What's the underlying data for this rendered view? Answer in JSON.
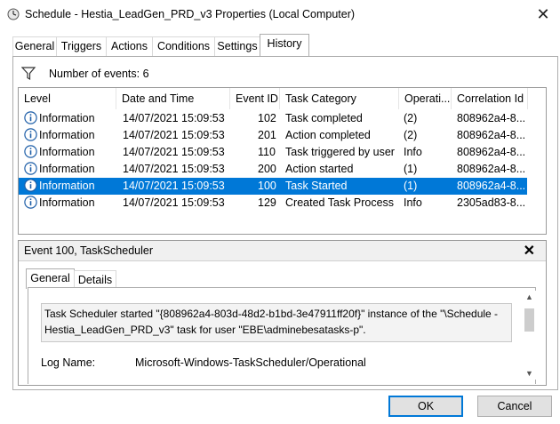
{
  "window": {
    "title": "Schedule - Hestia_LeadGen_PRD_v3 Properties (Local Computer)"
  },
  "tabs": [
    {
      "label": "General"
    },
    {
      "label": "Triggers"
    },
    {
      "label": "Actions"
    },
    {
      "label": "Conditions"
    },
    {
      "label": "Settings"
    },
    {
      "label": "History",
      "active": true
    }
  ],
  "history": {
    "filter_icon": "funnel-icon",
    "count_label": "Number of events: 6",
    "columns": [
      "Level",
      "Date and Time",
      "Event ID",
      "Task Category",
      "Operati...",
      "Correlation Id"
    ],
    "rows": [
      {
        "level": "Information",
        "datetime": "14/07/2021 15:09:53",
        "event_id": "102",
        "category": "Task completed",
        "opcode": "(2)",
        "correlation": "808962a4-8..."
      },
      {
        "level": "Information",
        "datetime": "14/07/2021 15:09:53",
        "event_id": "201",
        "category": "Action completed",
        "opcode": "(2)",
        "correlation": "808962a4-8..."
      },
      {
        "level": "Information",
        "datetime": "14/07/2021 15:09:53",
        "event_id": "110",
        "category": "Task triggered by user",
        "opcode": "Info",
        "correlation": "808962a4-8..."
      },
      {
        "level": "Information",
        "datetime": "14/07/2021 15:09:53",
        "event_id": "200",
        "category": "Action started",
        "opcode": "(1)",
        "correlation": "808962a4-8..."
      },
      {
        "level": "Information",
        "datetime": "14/07/2021 15:09:53",
        "event_id": "100",
        "category": "Task Started",
        "opcode": "(1)",
        "correlation": "808962a4-8...",
        "selected": true
      },
      {
        "level": "Information",
        "datetime": "14/07/2021 15:09:53",
        "event_id": "129",
        "category": "Created Task Process",
        "opcode": "Info",
        "correlation": "2305ad83-8..."
      }
    ]
  },
  "detail": {
    "title": "Event 100, TaskScheduler",
    "tabs": [
      {
        "label": "General",
        "active": true
      },
      {
        "label": "Details"
      }
    ],
    "message": "Task Scheduler started \"{808962a4-803d-48d2-b1bd-3e47911ff20f}\" instance of the \"\\Schedule - Hestia_LeadGen_PRD_v3\" task for user \"EBE\\adminebesatasks-p\".",
    "log_name_label": "Log Name:",
    "log_name_value": "Microsoft-Windows-TaskScheduler/Operational"
  },
  "buttons": {
    "ok": "OK",
    "cancel": "Cancel"
  },
  "colors": {
    "selection": "#0078d7",
    "info_icon": "#1f5fa8"
  }
}
